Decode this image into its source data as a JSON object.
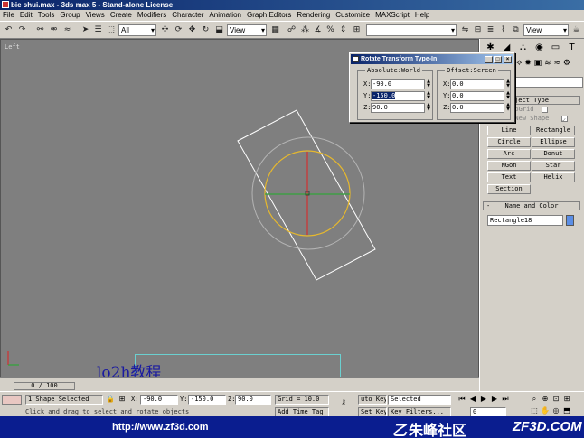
{
  "window": {
    "title": "bie shui.max - 3ds max 5 - Stand-alone License"
  },
  "menu": [
    "File",
    "Edit",
    "Tools",
    "Group",
    "Views",
    "Create",
    "Modifiers",
    "Character",
    "Animation",
    "Graph Editors",
    "Rendering",
    "Customize",
    "MAXScript",
    "Help"
  ],
  "toolbar": {
    "selection_filter": "All",
    "ref_coord": "View",
    "named_sel": "",
    "view_right": "View"
  },
  "viewport": {
    "label": "Left",
    "watermark": "lo2h教程"
  },
  "dialog": {
    "title": "Rotate Transform Type-In",
    "absolute_label": "Absolute:World",
    "offset_label": "Offset:Screen",
    "abs_x": "-90.0",
    "abs_y": "-150.0",
    "abs_z": "90.0",
    "off_x": "0.0",
    "off_y": "0.0",
    "off_z": "0.0",
    "x": "X:",
    "y": "Y:",
    "z": "Z:"
  },
  "command_panel": {
    "category": "s",
    "object_type_header": "ject Type",
    "autogrid": "utoGrid",
    "new_shape": "t New Shape",
    "buttons": [
      "Line",
      "Rectangle",
      "Circle",
      "Ellipse",
      "Arc",
      "Donut",
      "NGon",
      "Star",
      "Text",
      "Helix",
      "Section"
    ],
    "name_color_header": "Name and Color",
    "object_name": "Rectangle18"
  },
  "timeline": {
    "frame": "0 / 100"
  },
  "status": {
    "selection": "1 Shape Selected",
    "x_label": "X:",
    "x": "-90.0",
    "y_label": "Y:",
    "y": "-150.0",
    "z_label": "Z:",
    "z": "90.0",
    "grid": "Grid = 10.0",
    "auto_key": "uto Key",
    "set_key": "Set Key",
    "key_mode": "Selected",
    "key_filters": "Key Filters...",
    "add_time_tag": "Add Time Tag",
    "prompt": "Click and drag to select and rotate objects",
    "frame_field": "0"
  },
  "footer": {
    "url": "http://www.zf3d.com",
    "brand": "朱峰社区",
    "domain": "ZF3D.COM"
  }
}
